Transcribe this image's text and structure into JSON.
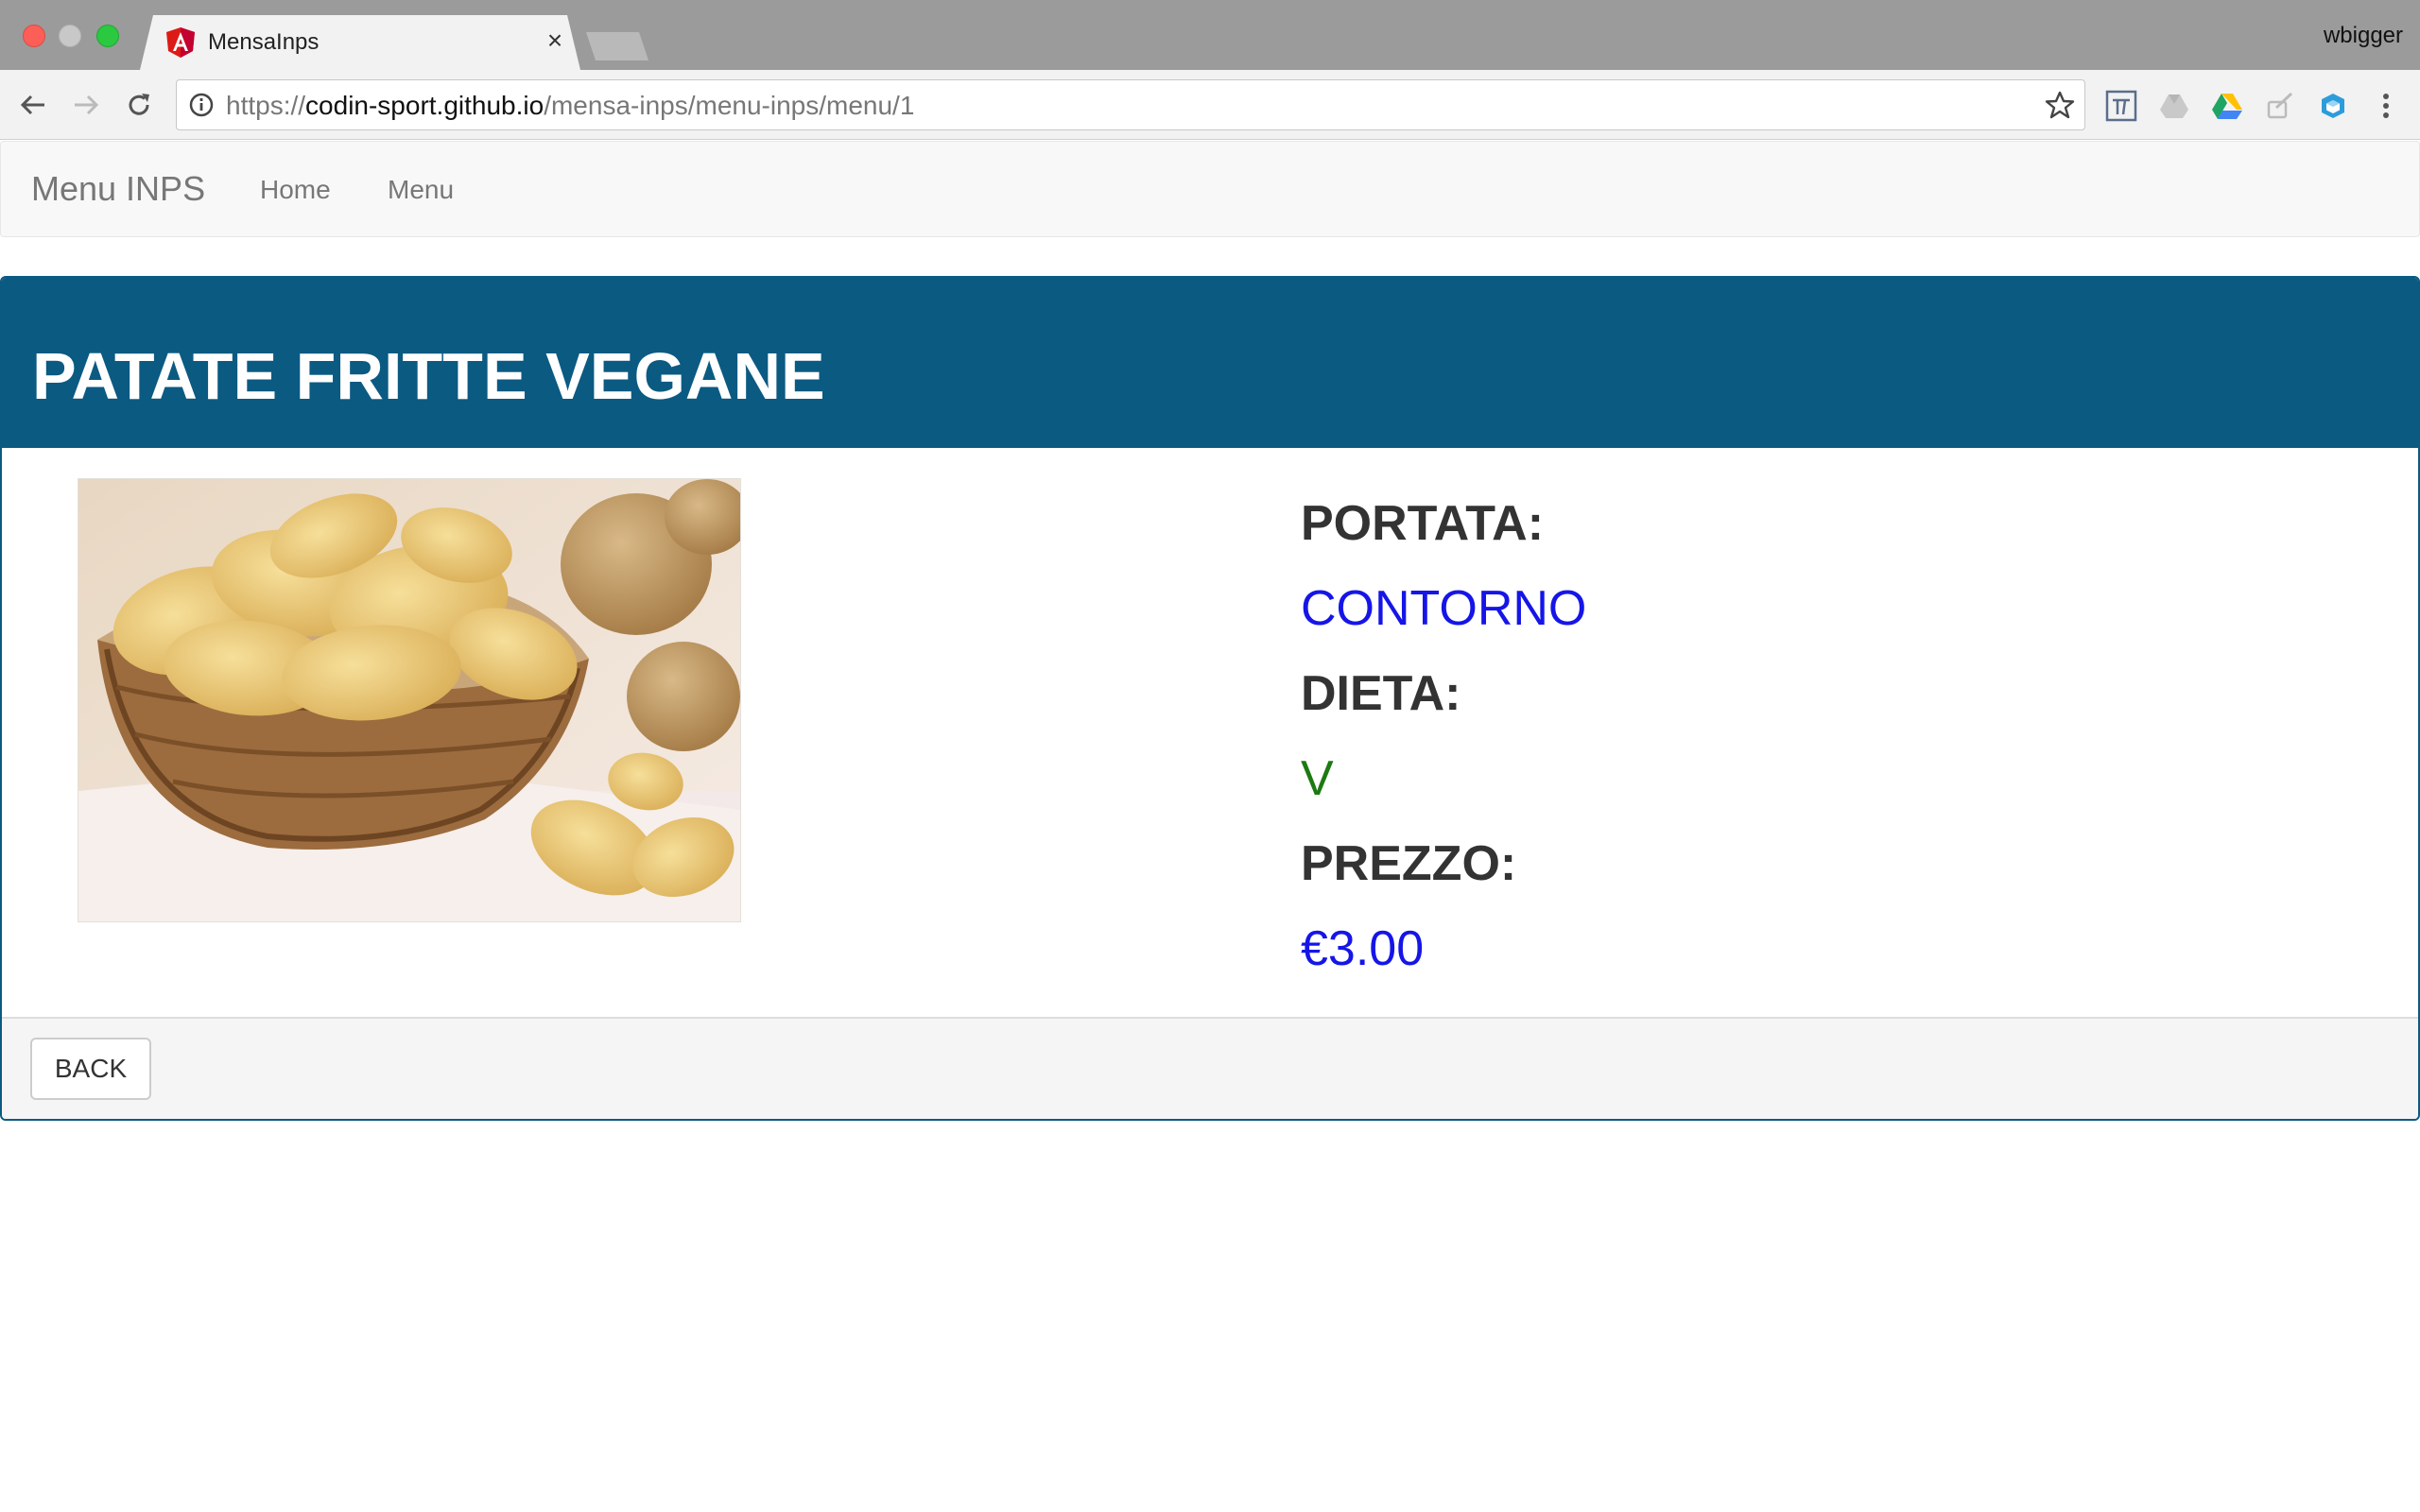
{
  "browser": {
    "tab_title": "MensaInps",
    "tab_close": "×",
    "profile_name": "wbigger",
    "url_scheme": "https://",
    "url_host": "codin-sport.github.io",
    "url_path": "/mensa-inps/menu-inps/menu/1",
    "extensions": [
      "formula-icon",
      "drive-grey-icon",
      "google-drive-icon",
      "paint-icon",
      "cube-icon"
    ]
  },
  "navbar": {
    "brand": "Menu INPS",
    "links": [
      "Home",
      "Menu"
    ]
  },
  "dish": {
    "title": "PATATE FRITTE VEGANE",
    "image_icon": "potato-chips-image",
    "portata_label": "PORTATA:",
    "portata_value": "CONTORNO",
    "dieta_label": "DIETA:",
    "dieta_value": "V",
    "prezzo_label": "PREZZO:",
    "prezzo_value": "€3.00"
  },
  "footer": {
    "back_label": "BACK"
  },
  "colors": {
    "panel_primary": "#0b5a82",
    "value_blue": "#1515e8",
    "value_green": "#1c7a12"
  }
}
